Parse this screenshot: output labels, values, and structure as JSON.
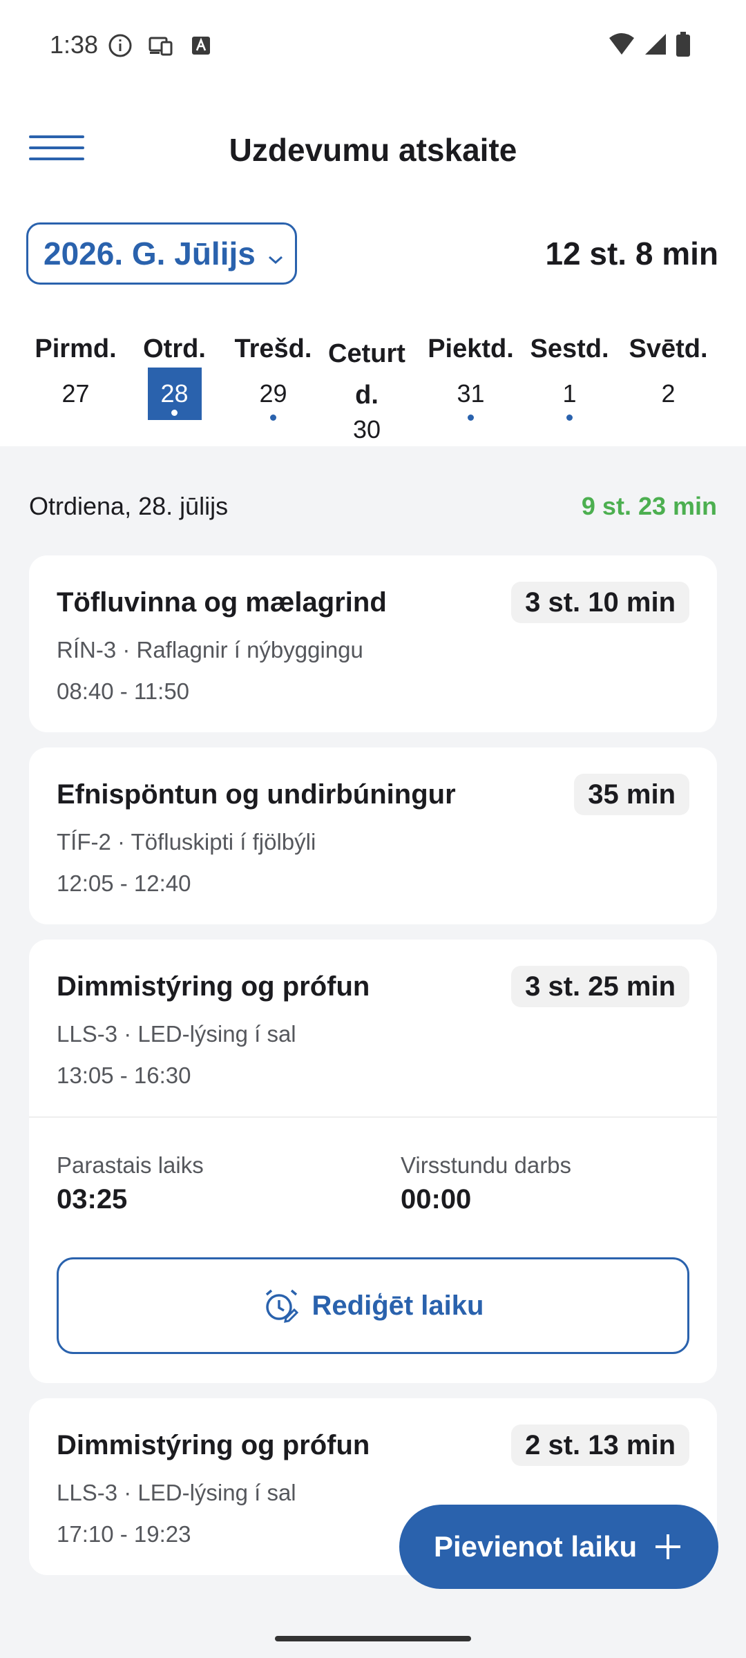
{
  "status_bar": {
    "time": "1:38",
    "left_icons": [
      "info-icon",
      "devices-icon",
      "a-icon"
    ],
    "right_icons": [
      "wifi-icon",
      "signal-icon",
      "battery-icon"
    ]
  },
  "app_bar": {
    "title": "Uzdevumu atskaite"
  },
  "period": {
    "month": "2026. G. Jūlijs",
    "total": "12 st. 8 min"
  },
  "week": {
    "days": [
      {
        "name": "Pirmd.",
        "num": "27",
        "has_dot": false,
        "selected": false
      },
      {
        "name": "Otrd.",
        "num": "28",
        "has_dot": true,
        "selected": true
      },
      {
        "name": "Trešd.",
        "num": "29",
        "has_dot": true,
        "selected": false
      },
      {
        "name": "Ceturt d.",
        "num": "30",
        "has_dot": false,
        "selected": false
      },
      {
        "name": "Piektd.",
        "num": "31",
        "has_dot": true,
        "selected": false
      },
      {
        "name": "Sestd.",
        "num": "1",
        "has_dot": true,
        "selected": false
      },
      {
        "name": "Svētd.",
        "num": "2",
        "has_dot": false,
        "selected": false
      }
    ]
  },
  "date_header": {
    "label": "Otrdiena, 28. jūlijs",
    "total": "9 st. 23 min"
  },
  "entries": [
    {
      "title": "Töfluvinna og mælagrind",
      "duration": "3 st. 10 min",
      "subtitle": "RÍN-3 · Raflagnir í nýbyggingu",
      "time": "08:40 - 11:50"
    },
    {
      "title": "Efnispöntun og undirbúningur",
      "duration": "35 min",
      "subtitle": "TÍF-2 · Töfluskipti í fjölbýli",
      "time": "12:05 - 12:40"
    },
    {
      "title": "Dimmistýring og prófun",
      "duration": "3 st. 25 min",
      "subtitle": "LLS-3 · LED-lýsing í sal",
      "time": "13:05 - 16:30",
      "expanded": {
        "regular_label": "Parastais laiks",
        "regular_value": "03:25",
        "overtime_label": "Virsstundu darbs",
        "overtime_value": "00:00",
        "edit_label": "Rediģēt laiku"
      }
    },
    {
      "title": "Dimmistýring og prófun",
      "duration": "2 st. 13 min",
      "subtitle": "LLS-3 · LED-lýsing í sal",
      "time": "17:10 - 19:23"
    }
  ],
  "fab": {
    "label": "Pievienot laiku"
  },
  "colors": {
    "primary": "#2a62ad",
    "positive": "#4caf50",
    "background": "#f3f4f6"
  }
}
